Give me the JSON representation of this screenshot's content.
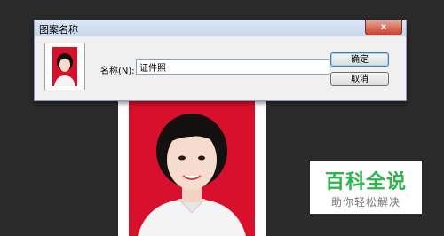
{
  "dialog": {
    "title": "图案名称",
    "close_label": "x",
    "name_label": "名称(N):",
    "name_value": "证件照",
    "ok_label": "确定",
    "cancel_label": "取消"
  },
  "watermark": {
    "title": "百科全说",
    "subtitle": "助你轻松解决"
  },
  "colors": {
    "photo_background": "#d8102b",
    "watermark_green": "#2ab54a"
  }
}
